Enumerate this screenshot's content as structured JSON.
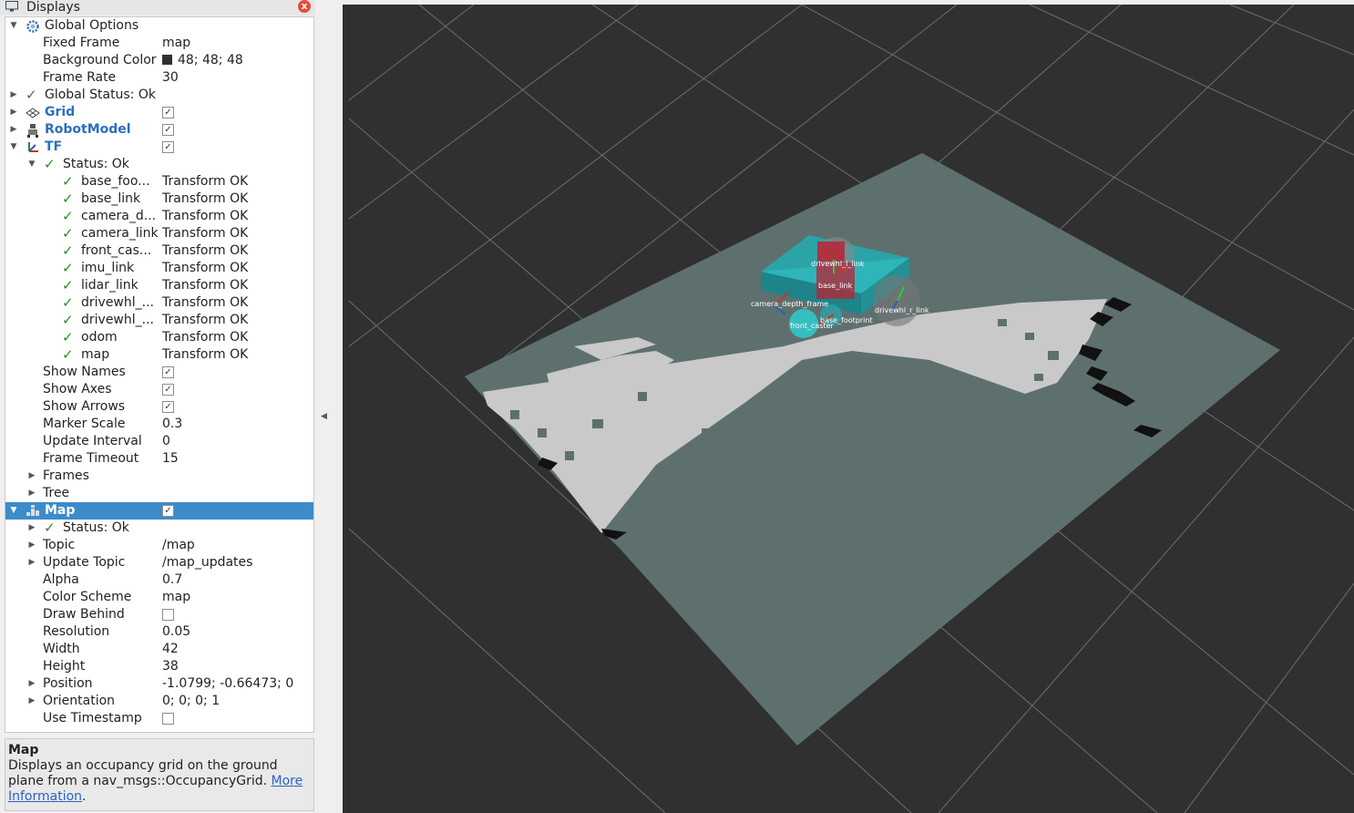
{
  "dock": {
    "title": "Displays",
    "close_glyph": "x"
  },
  "tree": {
    "global_options": "Global Options",
    "fixed_frame_label": "Fixed Frame",
    "fixed_frame_value": "map",
    "bg_color_label": "Background Color",
    "bg_color_value": "48; 48; 48",
    "frame_rate_label": "Frame Rate",
    "frame_rate_value": "30",
    "global_status": "Global Status: Ok",
    "grid": "Grid",
    "robot_model": "RobotModel",
    "tf": "TF",
    "tf_status": "Status: Ok",
    "tf_frames": [
      {
        "name": "base_foo...",
        "status": "Transform OK"
      },
      {
        "name": "base_link",
        "status": "Transform OK"
      },
      {
        "name": "camera_d...",
        "status": "Transform OK"
      },
      {
        "name": "camera_link",
        "status": "Transform OK"
      },
      {
        "name": "front_cas...",
        "status": "Transform OK"
      },
      {
        "name": "imu_link",
        "status": "Transform OK"
      },
      {
        "name": "lidar_link",
        "status": "Transform OK"
      },
      {
        "name": "drivewhl_...",
        "status": "Transform OK"
      },
      {
        "name": "drivewhl_...",
        "status": "Transform OK"
      },
      {
        "name": "odom",
        "status": "Transform OK"
      },
      {
        "name": "map",
        "status": "Transform OK"
      }
    ],
    "show_names": "Show Names",
    "show_axes": "Show Axes",
    "show_arrows": "Show Arrows",
    "marker_scale_label": "Marker Scale",
    "marker_scale_value": "0.3",
    "update_interval_label": "Update Interval",
    "update_interval_value": "0",
    "frame_timeout_label": "Frame Timeout",
    "frame_timeout_value": "15",
    "frames": "Frames",
    "tree_item": "Tree",
    "map": "Map",
    "map_status": "Status: Ok",
    "topic_label": "Topic",
    "topic_value": "/map",
    "update_topic_label": "Update Topic",
    "update_topic_value": "/map_updates",
    "alpha_label": "Alpha",
    "alpha_value": "0.7",
    "color_scheme_label": "Color Scheme",
    "color_scheme_value": "map",
    "draw_behind_label": "Draw Behind",
    "resolution_label": "Resolution",
    "resolution_value": "0.05",
    "width_label": "Width",
    "width_value": "42",
    "height_label": "Height",
    "height_value": "38",
    "position_label": "Position",
    "position_value": "-1.0799; -0.66473; 0",
    "orientation_label": "Orientation",
    "orientation_value": "0; 0; 0; 1",
    "use_timestamp_label": "Use Timestamp"
  },
  "help": {
    "title": "Map",
    "text": "Displays an occupancy grid on the ground plane from a nav_msgs::OccupancyGrid.",
    "link1": "More",
    "link2": "Information",
    "tail": "."
  },
  "view3d": {
    "frame_labels": [
      "drivewhl_l_link",
      "drivewhl_r_link",
      "camera_depth_frame",
      "base_footprint",
      "front_caster",
      "base_link"
    ],
    "background": "#303030",
    "map_color": "#5e706e",
    "robot_color": "#27a8ad"
  }
}
